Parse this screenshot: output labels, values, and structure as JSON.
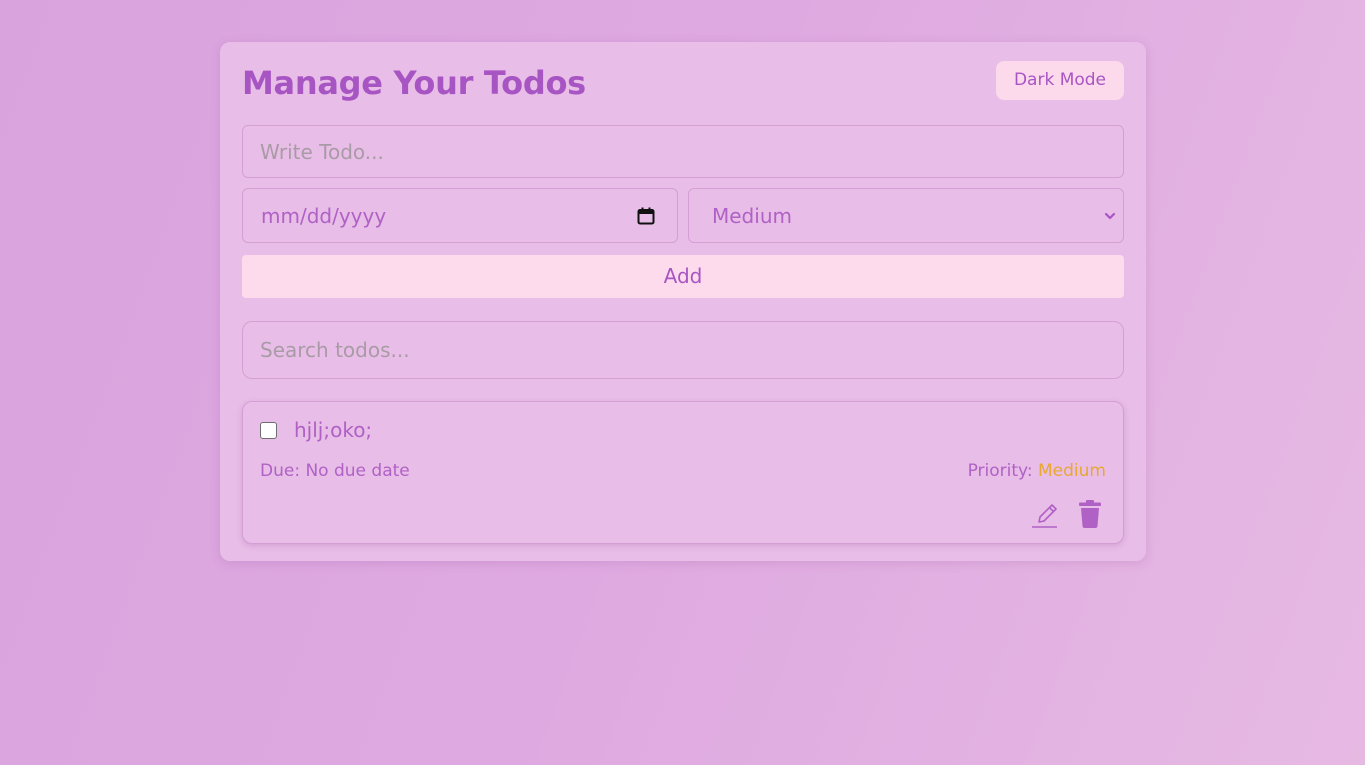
{
  "header": {
    "title": "Manage Your Todos",
    "dark_mode_label": "Dark Mode"
  },
  "form": {
    "todo_placeholder": "Write Todo...",
    "date_placeholder": "mm/dd/yyyy",
    "priority_selected": "Medium",
    "add_label": "Add"
  },
  "search": {
    "placeholder": "Search todos..."
  },
  "todos": [
    {
      "text": "hjlj;oko;",
      "completed": false,
      "due": "Due: No due date",
      "priority_label": "Priority:",
      "priority_value": "Medium"
    }
  ],
  "colors": {
    "accent": "#a855c4",
    "background": "#dea8e0",
    "card": "#e8bde7",
    "button": "#fddbed",
    "priority_medium": "#e8a832"
  },
  "icons": {
    "date": "calendar-icon",
    "select": "chevron-down-icon",
    "edit": "pencil-icon",
    "delete": "trash-icon"
  }
}
